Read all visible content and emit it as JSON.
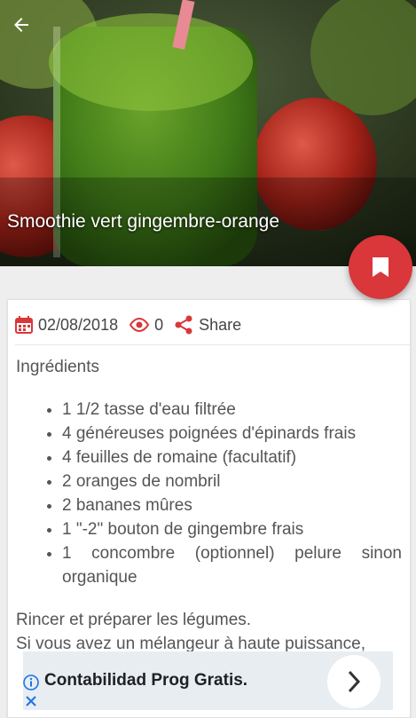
{
  "hero": {
    "title": "Smoothie vert gingembre-orange"
  },
  "icons": {
    "back": "arrow-left-icon",
    "bookmark": "bookmark-icon",
    "date": "calendar-icon",
    "views": "eye-icon",
    "share": "share-icon",
    "ad_info": "info-icon",
    "ad_next": "chevron-right-icon",
    "ad_close": "close-icon"
  },
  "colors": {
    "accent": "#d9373a",
    "text": "#555555",
    "ad_background": "#e8edf2",
    "ad_blue": "#1a73e8"
  },
  "meta": {
    "date": "02/08/2018",
    "views": "0",
    "share_label": "Share"
  },
  "content": {
    "heading": "Ingrédients",
    "ingredients": [
      "1 1/2 tasse d'eau filtrée",
      "4 généreuses poignées d'épinards frais",
      "4 feuilles de romaine (facultatif)",
      "2 oranges de nombril",
      "2 bananes mûres",
      "1 \"-2\" bouton de gingembre frais",
      "1 concombre (optionnel) pelure sinon organique"
    ],
    "paragraph_1": "Rincer et préparer les légumes.",
    "paragraph_2": "Si vous avez un mélangeur à haute puissance,"
  },
  "ad": {
    "text": "Contabilidad Prog Gratis."
  }
}
